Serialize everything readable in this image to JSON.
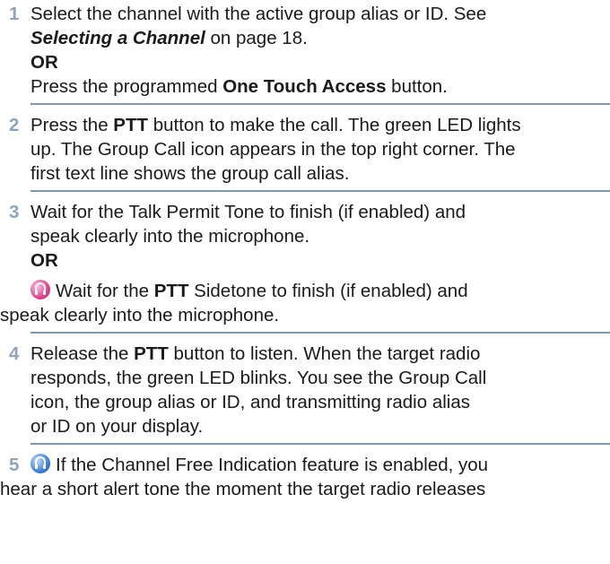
{
  "steps": [
    {
      "num": "1",
      "l1": "Select the channel with the active group alias or ID. See",
      "l2_ref": "Selecting a Channel",
      "l2_rest": " on page 18.",
      "or": "OR",
      "l3_a": "Press the programmed ",
      "l3_b": "One Touch Access",
      "l3_c": " button."
    },
    {
      "num": "2",
      "l1_a": "Press the ",
      "l1_b": "PTT",
      "l1_c": " button to make the call. The green LED lights",
      "l2": "up. The Group Call icon appears in the top right corner. The",
      "l3": "first text line shows the group call alias."
    },
    {
      "num": "3",
      "l1": "Wait for the Talk Permit Tone to finish (if enabled) and",
      "l2": "speak clearly into the microphone.",
      "or": "OR",
      "l3_a": "Wait for the ",
      "l3_b": "PTT",
      "l3_c": " Sidetone to finish (if enabled) and",
      "l4": "speak clearly into the microphone."
    },
    {
      "num": "4",
      "l1_a": "Release the ",
      "l1_b": "PTT",
      "l1_c": " button to listen. When the target radio",
      "l2": "responds, the green LED blinks. You see the Group Call",
      "l3": "icon, the group alias or ID, and transmitting radio alias",
      "l4": "or ID on your display."
    },
    {
      "num": "5",
      "l1": "If the Channel Free Indication feature is enabled, you",
      "l2": "hear a short alert tone the moment the target radio releases"
    }
  ],
  "icons": {
    "sidetone": "sidetone-icon",
    "channel_free": "channel-free-icon",
    "pink": "#e0448d",
    "blue": "#3f7fd8"
  }
}
